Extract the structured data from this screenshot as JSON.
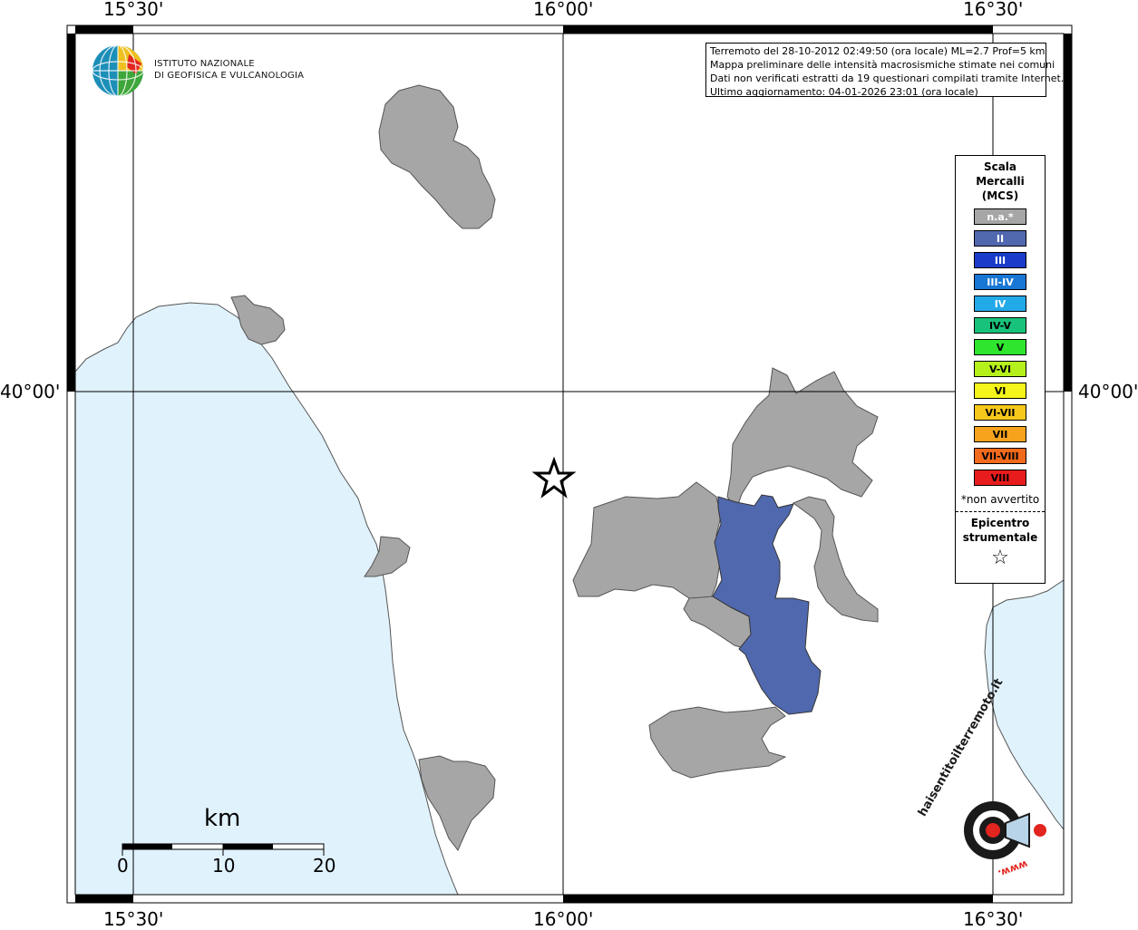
{
  "map": {
    "lon_labels": [
      "15°30'",
      "16°00'",
      "16°30'"
    ],
    "lat_labels": [
      "40°00'"
    ],
    "epicenter_marker": "star-icon",
    "colors": {
      "sea": "#e0f2fc",
      "land_outline": "#555555",
      "municipality_na": "#a6a6a6",
      "municipality_intensity_II": "#5068ae"
    }
  },
  "logo": {
    "line1": "ISTITUTO NAZIONALE",
    "line2": "DI GEOFISICA E VULCANOLOGIA"
  },
  "info": {
    "line1": "Terremoto del 28-10-2012 02:49:50 (ora locale) ML=2.7 Prof=5 km",
    "line2": "Mappa preliminare delle intensità macrosismiche stimate nei comuni",
    "line3": "Dati non verificati estratti da 19 questionari compilati tramite Internet.",
    "line4": "Ultimo aggiornamento: 04-01-2026 23:01 (ora locale)"
  },
  "legend": {
    "title_line1": "Scala",
    "title_line2": "Mercalli",
    "title_line3": "(MCS)",
    "items": [
      {
        "label": "n.a.*",
        "color": "#a6a6a6",
        "text_color": "#ffffff"
      },
      {
        "label": "II",
        "color": "#5068ae",
        "text_color": "#ffffff"
      },
      {
        "label": "III",
        "color": "#1a3cc8",
        "text_color": "#ffffff"
      },
      {
        "label": "III-IV",
        "color": "#1877d4",
        "text_color": "#ffffff"
      },
      {
        "label": "IV",
        "color": "#22a9e8",
        "text_color": "#ffffff"
      },
      {
        "label": "IV-V",
        "color": "#19c27a",
        "text_color": "#000000"
      },
      {
        "label": "V",
        "color": "#2ee62e",
        "text_color": "#000000"
      },
      {
        "label": "V-VI",
        "color": "#b6f01c",
        "text_color": "#000000"
      },
      {
        "label": "VI",
        "color": "#f5f51c",
        "text_color": "#000000"
      },
      {
        "label": "VI-VII",
        "color": "#f7c81c",
        "text_color": "#000000"
      },
      {
        "label": "VII",
        "color": "#f7a41c",
        "text_color": "#000000"
      },
      {
        "label": "VII-VIII",
        "color": "#f26a1c",
        "text_color": "#000000"
      },
      {
        "label": "VIII",
        "color": "#e81c1c",
        "text_color": "#000000"
      }
    ],
    "note": "*non avvertito",
    "epicenter_line1": "Epicentro",
    "epicenter_line2": "strumentale",
    "epicenter_icon": "star-icon"
  },
  "scale_bar": {
    "unit": "km",
    "ticks": [
      "0",
      "10",
      "20"
    ]
  },
  "watermark": {
    "text": "haisentitoilterremoto.it",
    "url_text": "www.",
    "icon": "target-megaphone-icon"
  }
}
